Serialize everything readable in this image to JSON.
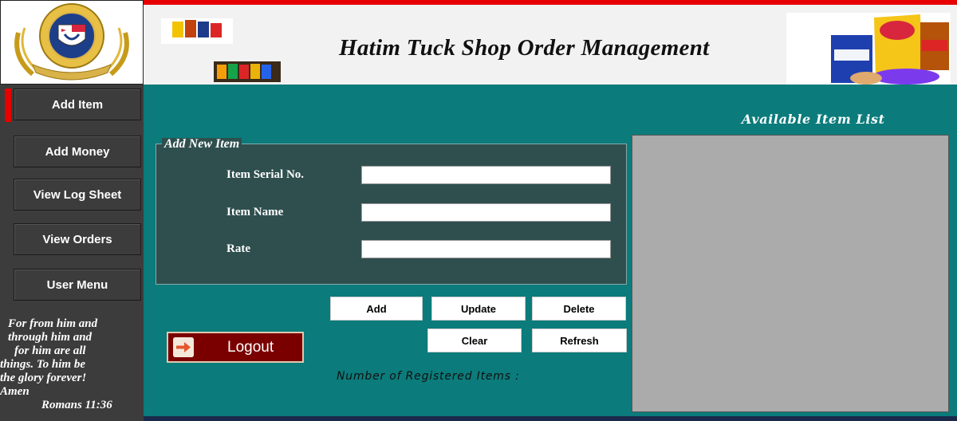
{
  "header": {
    "title": "Hatim Tuck Shop Order Management"
  },
  "sidebar": {
    "items": [
      {
        "label": "Add Item"
      },
      {
        "label": "Add Money"
      },
      {
        "label": "View Log Sheet"
      },
      {
        "label": "View Orders"
      },
      {
        "label": "User Menu"
      }
    ],
    "active_index": 0,
    "verse": {
      "lines": [
        "For from him and",
        "through him and",
        "for him are all",
        "things. To him be",
        "the glory forever!",
        "Amen"
      ],
      "reference": "Romans 11:36"
    }
  },
  "form": {
    "group_title": "Add New Item",
    "fields": [
      {
        "label": "Item Serial No.",
        "value": ""
      },
      {
        "label": "Item Name",
        "value": ""
      },
      {
        "label": "Rate",
        "value": ""
      }
    ]
  },
  "buttons": {
    "add": "Add",
    "update": "Update",
    "delete": "Delete",
    "clear": "Clear",
    "refresh": "Refresh",
    "logout": "Logout"
  },
  "item_list": {
    "title": "Available Item List"
  },
  "status": {
    "registered_label": "Number of Registered Items :"
  },
  "colors": {
    "accent_red": "#e60000",
    "main_teal": "#0b7b7b",
    "groupbox": "#2f4f4f",
    "sidebar": "#3c3c3c",
    "logout_bg": "#7a0000"
  }
}
